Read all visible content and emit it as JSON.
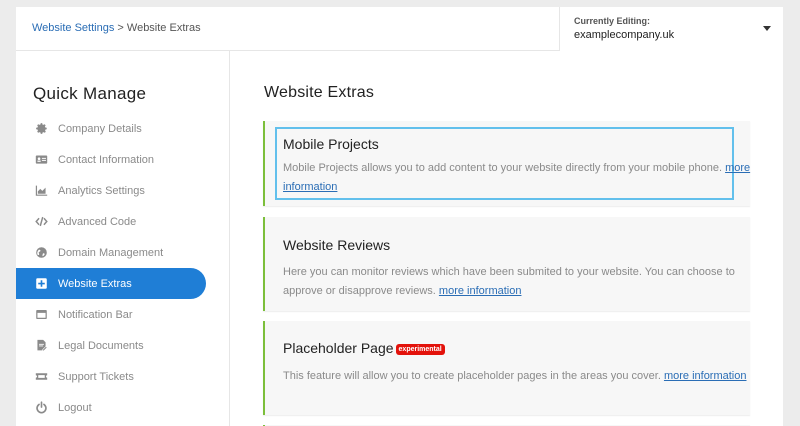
{
  "breadcrumb": {
    "parent": "Website Settings",
    "separator": " > ",
    "current": "Website Extras"
  },
  "editing": {
    "label": "Currently Editing:",
    "value": "examplecompany.uk"
  },
  "sidebar": {
    "title": "Quick Manage",
    "items": [
      {
        "label": "Company Details",
        "icon": "gear-icon"
      },
      {
        "label": "Contact Information",
        "icon": "id-card-icon"
      },
      {
        "label": "Analytics Settings",
        "icon": "chart-icon"
      },
      {
        "label": "Advanced Code",
        "icon": "code-icon"
      },
      {
        "label": "Domain Management",
        "icon": "globe-icon"
      },
      {
        "label": "Website Extras",
        "icon": "plus-square-icon"
      },
      {
        "label": "Notification Bar",
        "icon": "window-icon"
      },
      {
        "label": "Legal Documents",
        "icon": "document-icon"
      },
      {
        "label": "Support Tickets",
        "icon": "ticket-icon"
      },
      {
        "label": "Logout",
        "icon": "power-icon"
      }
    ],
    "active_index": 5
  },
  "main": {
    "title": "Website Extras",
    "cards": [
      {
        "title": "Mobile Projects",
        "desc": "Mobile Projects allows you to add content to your website directly from your mobile phone.",
        "link": "more information"
      },
      {
        "title": "Website Reviews",
        "desc": "Here you can monitor reviews which have been submited to your website. You can choose to approve or disapprove reviews.",
        "link": "more information"
      },
      {
        "title": "Placeholder Page",
        "badge": "experimental",
        "desc": "This feature will allow you to create placeholder pages in the areas you cover.",
        "link": "more information"
      }
    ]
  },
  "colors": {
    "accent": "#1f7ed6",
    "card_border": "#7cbf3b",
    "link": "#2a6db5",
    "badge": "#e3120b",
    "highlight": "#62c0ec"
  }
}
